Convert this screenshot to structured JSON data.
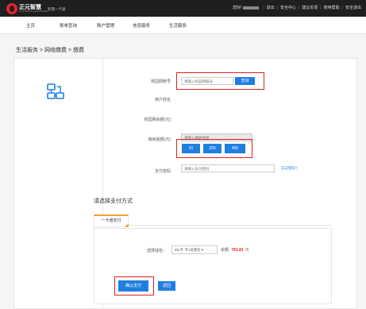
{
  "header": {
    "logo_name": "正元智慧",
    "logo_sub": "SYNTHESIS ELECTRONIC",
    "slogan": "智慧一卡通",
    "greeting": "您好!",
    "links": [
      "退出",
      "安全中心",
      "建议反馈",
      "使用帮助",
      "安全退出"
    ]
  },
  "nav": {
    "items": [
      "主页",
      "账单查询",
      "账户管理",
      "信息服务",
      "生活服务"
    ]
  },
  "breadcrumb": "生活服务 > 网络缴费 > 缴费",
  "form": {
    "account_label": "校园网账号",
    "account_placeholder": "请输入校园网账号",
    "query_label": "查询",
    "name_label": "用户姓名",
    "balance_label": "校园网余额(元)",
    "amount_label": "缴纳金额(元)",
    "amount_placeholder": "请输入缴纳金额",
    "amount_options": [
      "20",
      "200",
      "400"
    ],
    "password_label": "支付密码",
    "password_placeholder": "请输入支付密码",
    "forgot_label": "忘记密码?"
  },
  "payment": {
    "title": "请选择支付方式",
    "tab_label": "一卡通支付",
    "wallet_label": "选择钱包：",
    "wallet_value": "M1卡-卡1号钱包 ▾",
    "balance_label": "余额:",
    "balance_value": "781.81",
    "balance_unit": "元",
    "confirm_label": "确认支付",
    "back_label": "返回"
  },
  "colors": {
    "accent": "#1f7fe0",
    "highlight": "#e02020",
    "brand": "#e6232d"
  }
}
